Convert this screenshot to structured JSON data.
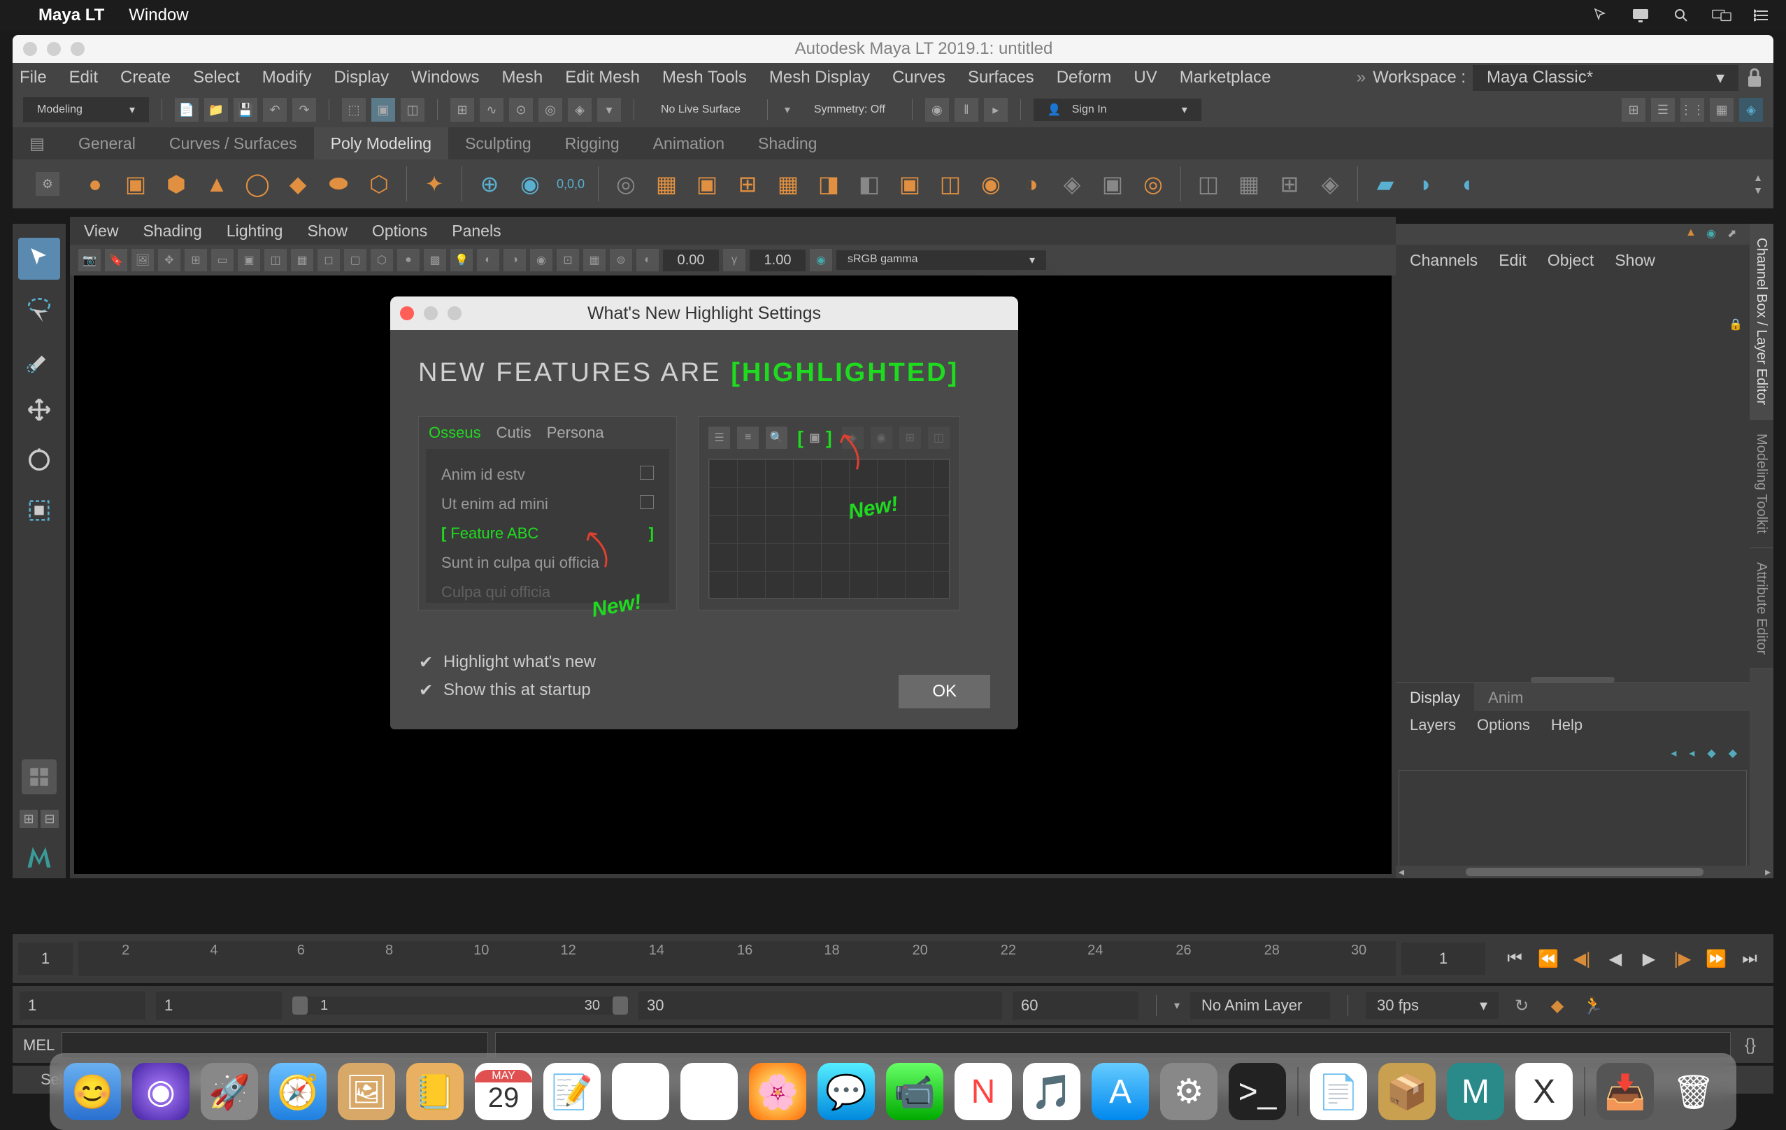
{
  "mac_menubar": {
    "app_name": "Maya LT",
    "menus": [
      "Window"
    ]
  },
  "window_title": "Autodesk Maya LT 2019.1: untitled",
  "maya_menus": [
    "File",
    "Edit",
    "Create",
    "Select",
    "Modify",
    "Display",
    "Windows",
    "Mesh",
    "Edit Mesh",
    "Mesh Tools",
    "Mesh Display",
    "Curves",
    "Surfaces",
    "Deform",
    "UV",
    "Marketplace"
  ],
  "workspace": {
    "label": "Workspace :",
    "value": "Maya Classic*"
  },
  "status_line": {
    "mode": "Modeling",
    "no_live_surface": "No Live Surface",
    "symmetry": "Symmetry: Off",
    "signin": "Sign In"
  },
  "shelf_tabs": [
    "General",
    "Curves / Surfaces",
    "Poly Modeling",
    "Sculpting",
    "Rigging",
    "Animation",
    "Shading"
  ],
  "shelf_active_index": 2,
  "viewport": {
    "menus": [
      "View",
      "Shading",
      "Lighting",
      "Show",
      "Options",
      "Panels"
    ],
    "val1": "0.00",
    "val2": "1.00",
    "color_space": "sRGB gamma"
  },
  "right_panel": {
    "vtabs": [
      "Channel Box / Layer Editor",
      "Modeling Toolkit",
      "Attribute Editor"
    ],
    "menus": [
      "Channels",
      "Edit",
      "Object",
      "Show"
    ],
    "layers": {
      "tabs": [
        "Display",
        "Anim"
      ],
      "menus": [
        "Layers",
        "Options",
        "Help"
      ]
    }
  },
  "timeline": {
    "start": "1",
    "ticks": [
      "2",
      "4",
      "6",
      "8",
      "10",
      "12",
      "14",
      "16",
      "18",
      "20",
      "22",
      "24",
      "26",
      "28",
      "30"
    ],
    "end": "1"
  },
  "range": {
    "anim_start": "1",
    "playback_start": "1",
    "range_label_start": "1",
    "range_label_end": "30",
    "playback_end": "30",
    "anim_end": "60",
    "layer": "No Anim Layer",
    "fps": "30 fps"
  },
  "console": {
    "label": "MEL"
  },
  "help_line": "Select Tool: select an object",
  "dialog": {
    "title": "What's New Highlight Settings",
    "heading_pre": "NEW FEATURES ARE ",
    "heading_hl": "[HIGHLIGHTED]",
    "preview_tabs": [
      "Osseus",
      "Cutis",
      "Persona"
    ],
    "preview_items": [
      "Anim id estv",
      "Ut enim ad mini",
      "Feature ABC",
      "Sunt in culpa qui officia",
      "Culpa qui officia"
    ],
    "new_label1": "New!",
    "new_label2": "New!",
    "check1": "Highlight what's new",
    "check2": "Show this at startup",
    "ok": "OK"
  },
  "dock_cal_num": "29",
  "dock_cal_month": "MAY"
}
